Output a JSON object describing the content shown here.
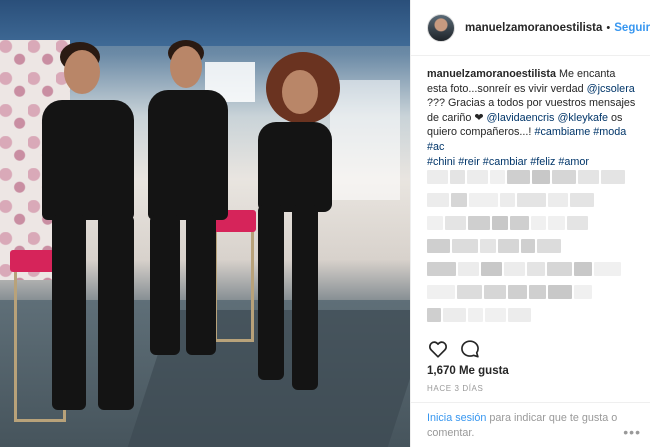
{
  "header": {
    "username": "manuelzamoranoestilista",
    "separator": "•",
    "follow_label": "Seguir"
  },
  "caption": {
    "username": "manuelzamoranoestilista",
    "text_1": " Me encanta esta foto...sonreír es vivir verdad ",
    "mention_1": "@jcsolera",
    "text_2": " ??? Gracias a todos por vuestros mensajes de cariño ❤ ",
    "mention_2": "@lavidaencris",
    "text_3": " ",
    "mention_3": "@kleykafe",
    "text_4": " os quiero compañeros...! ",
    "hashtags_a": "#cambiame #moda #ac",
    "hashtags_b": "#chini #reir #cambiar #feliz #amor"
  },
  "likes": {
    "count_label": "1,670 Me gusta"
  },
  "timestamp": "HACE 3 DÍAS",
  "login": {
    "signin_label": "Inicia sesión",
    "prompt": " para indicar que te gusta o comentar."
  },
  "icons": {
    "like": "heart-icon",
    "comment": "comment-icon",
    "more": "more-options-icon"
  },
  "colors": {
    "link_blue": "#3897f0",
    "text_dark": "#262626",
    "muted": "#999999",
    "caption_link": "#003569"
  }
}
